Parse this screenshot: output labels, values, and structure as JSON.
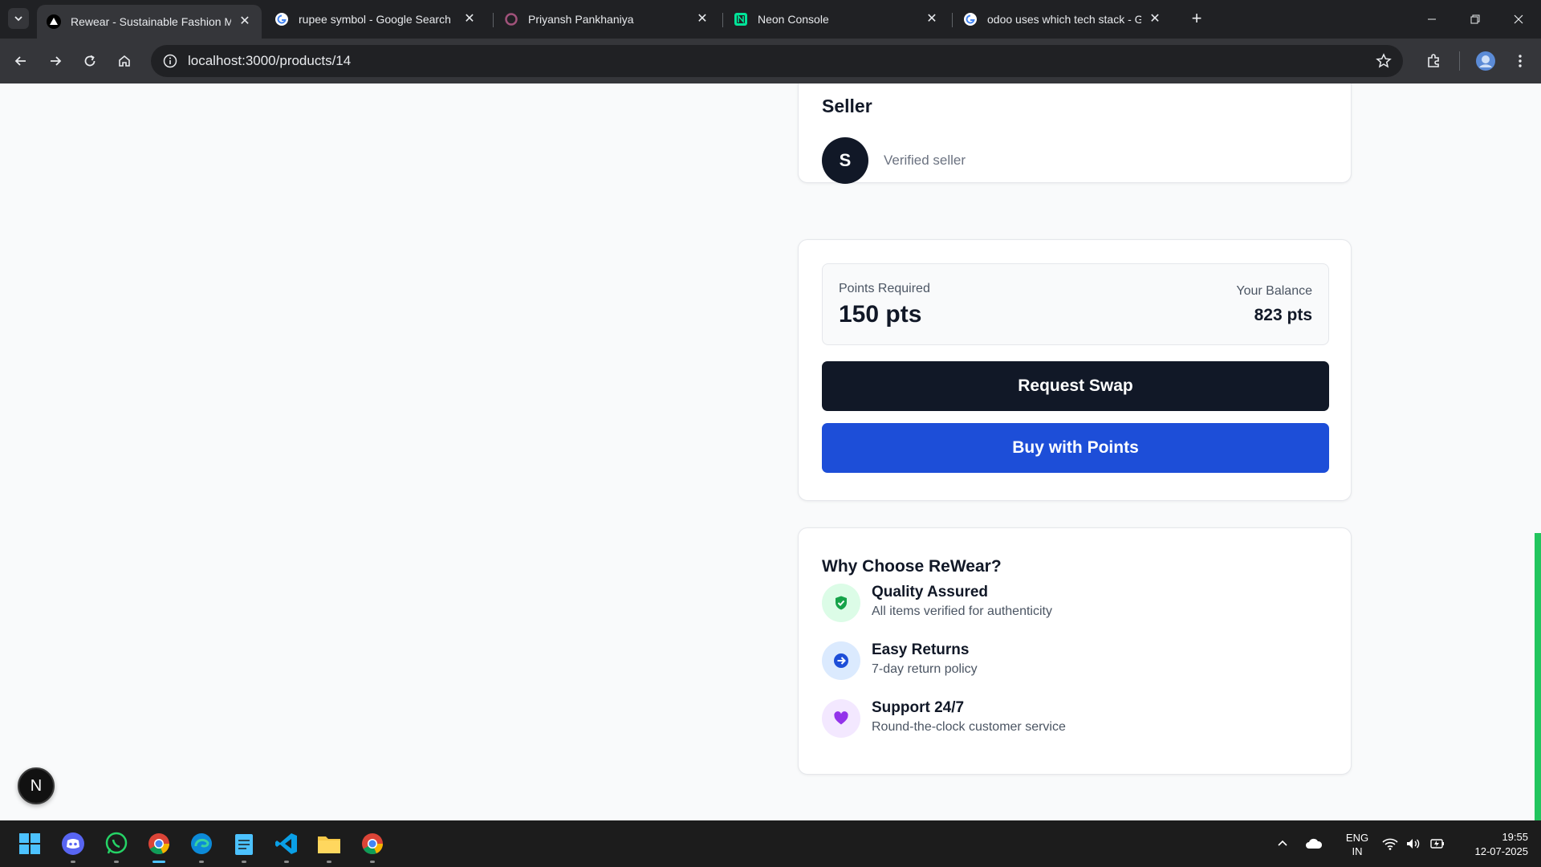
{
  "browser": {
    "tabs": [
      {
        "title": "Rewear - Sustainable Fashion M",
        "favicon": "triangle-logo-icon",
        "active": true
      },
      {
        "title": "rupee symbol - Google Search",
        "favicon": "google-icon",
        "active": false
      },
      {
        "title": "Priyansh Pankhaniya",
        "favicon": "circle-logo-icon",
        "active": false
      },
      {
        "title": "Neon Console",
        "favicon": "neon-logo-icon",
        "active": false
      },
      {
        "title": "odoo uses which tech stack - Go",
        "favicon": "google-icon",
        "active": false
      }
    ],
    "url": "localhost:3000/products/14"
  },
  "seller": {
    "heading": "Seller",
    "avatar_initial": "S",
    "subtitle": "Verified seller"
  },
  "points": {
    "required_label": "Points Required",
    "required_value": "150 pts",
    "balance_label": "Your Balance",
    "balance_value": "823 pts",
    "swap_button": "Request Swap",
    "buy_button": "Buy with Points"
  },
  "why": {
    "heading": "Why Choose ReWear?",
    "features": [
      {
        "title": "Quality Assured",
        "desc": "All items verified for authenticity",
        "icon": "shield-check-icon",
        "color": "#16a34a",
        "bg": "#dcfce7"
      },
      {
        "title": "Easy Returns",
        "desc": "7-day return policy",
        "icon": "arrow-right-circle-icon",
        "color": "#1d4ed8",
        "bg": "#dbeafe"
      },
      {
        "title": "Support 24/7",
        "desc": "Round-the-clock customer service",
        "icon": "heart-icon",
        "color": "#9333ea",
        "bg": "#f3e8ff"
      }
    ]
  },
  "dev_badge": "N",
  "taskbar": {
    "language": "ENG",
    "region": "IN",
    "time": "19:55",
    "date": "12-07-2025"
  }
}
